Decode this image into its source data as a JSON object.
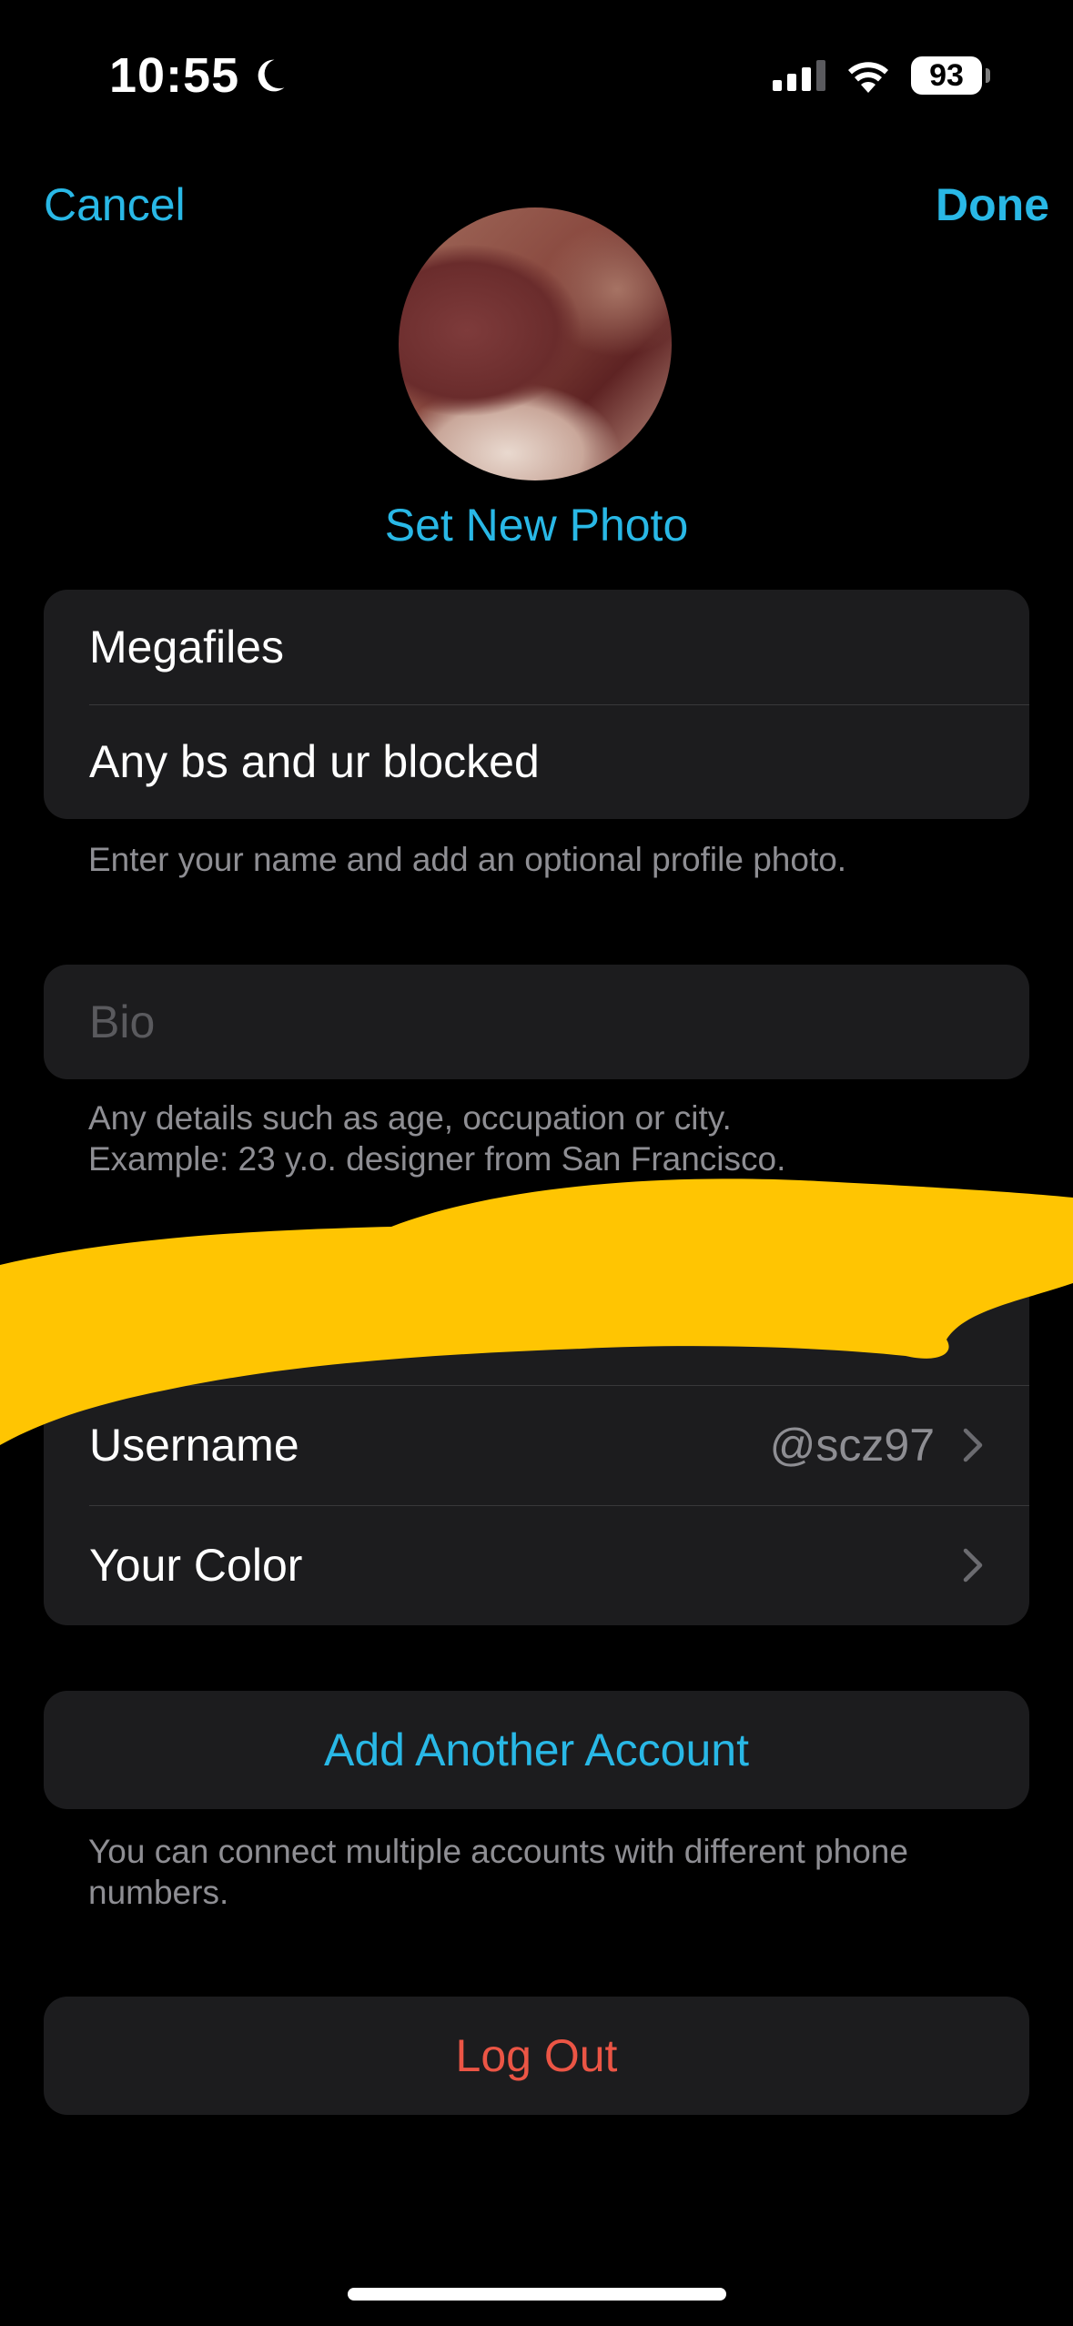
{
  "status_bar": {
    "time": "10:55",
    "battery": "93",
    "icons": [
      "moon-icon",
      "signal-icon",
      "wifi-icon",
      "battery-icon"
    ]
  },
  "nav": {
    "cancel": "Cancel",
    "done": "Done"
  },
  "profile": {
    "set_photo": "Set New Photo"
  },
  "name_group": {
    "first_name": "Megafiles",
    "last_name": "Any bs and ur blocked",
    "footnote": "Enter your name and add an optional profile photo."
  },
  "bio": {
    "placeholder": "Bio",
    "footnote_line1": "Any details such as age, occupation or city.",
    "footnote_line2": "Example: 23 y.o. designer from San Francisco."
  },
  "account_group": {
    "username_label": "Username",
    "username_value": "@scz97",
    "color_label": "Your Color"
  },
  "add_account": {
    "label": "Add Another Account",
    "footnote": "You can connect multiple accounts with different phone numbers."
  },
  "logout": {
    "label": "Log Out"
  },
  "colors": {
    "accent": "#29b8e6",
    "destructive": "#eb5545",
    "cell_background": "#1c1c1e",
    "redaction": "#ffc502"
  }
}
